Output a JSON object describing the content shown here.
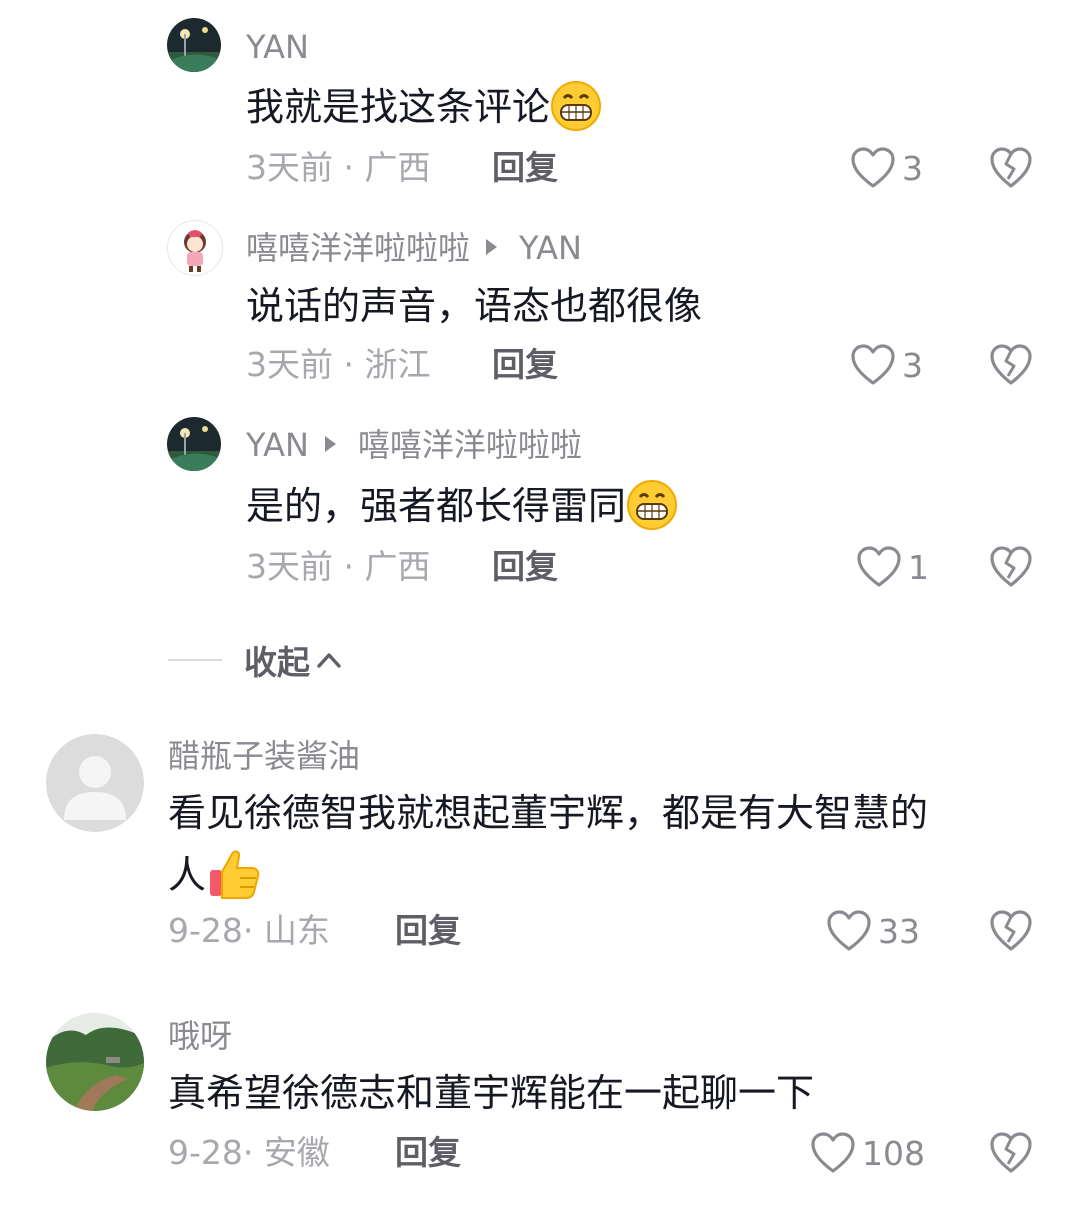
{
  "comments": [
    {
      "username": "YAN",
      "reply_to": "",
      "text": "我就是找这条评论",
      "emoji": "grin-emoji",
      "date": "3天前",
      "location": "广西",
      "reply_label": "回复",
      "likes": "3"
    },
    {
      "username": "嘻嘻洋洋啦啦啦",
      "reply_to": "YAN",
      "text": "说话的声音，语态也都很像",
      "emoji": "",
      "date": "3天前",
      "location": "浙江",
      "reply_label": "回复",
      "likes": "3"
    },
    {
      "username": "YAN",
      "reply_to": "嘻嘻洋洋啦啦啦",
      "text": "是的，强者都长得雷同",
      "emoji": "grin-emoji",
      "date": "3天前",
      "location": "广西",
      "reply_label": "回复",
      "likes": "1"
    },
    {
      "username": "醋瓶子装酱油",
      "reply_to": "",
      "text_line1": "看见徐德智我就想起董宇辉，都是有大智慧的",
      "text_line2": "人",
      "emoji": "thumbs-up-emoji",
      "date": "9-28",
      "location": "山东",
      "reply_label": "回复",
      "likes": "33"
    },
    {
      "username": "哦呀",
      "reply_to": "",
      "text": "真希望徐德志和董宇辉能在一起聊一下",
      "emoji": "",
      "date": "9-28",
      "location": "安徽",
      "reply_label": "回复",
      "likes": "108"
    }
  ],
  "collapse_label": "收起",
  "meta_separator": "·",
  "colors": {
    "text": "#161823",
    "username": "#8a8b91",
    "meta": "#a7a8ad",
    "reply": "#5e5f66",
    "background": "#ffffff"
  }
}
